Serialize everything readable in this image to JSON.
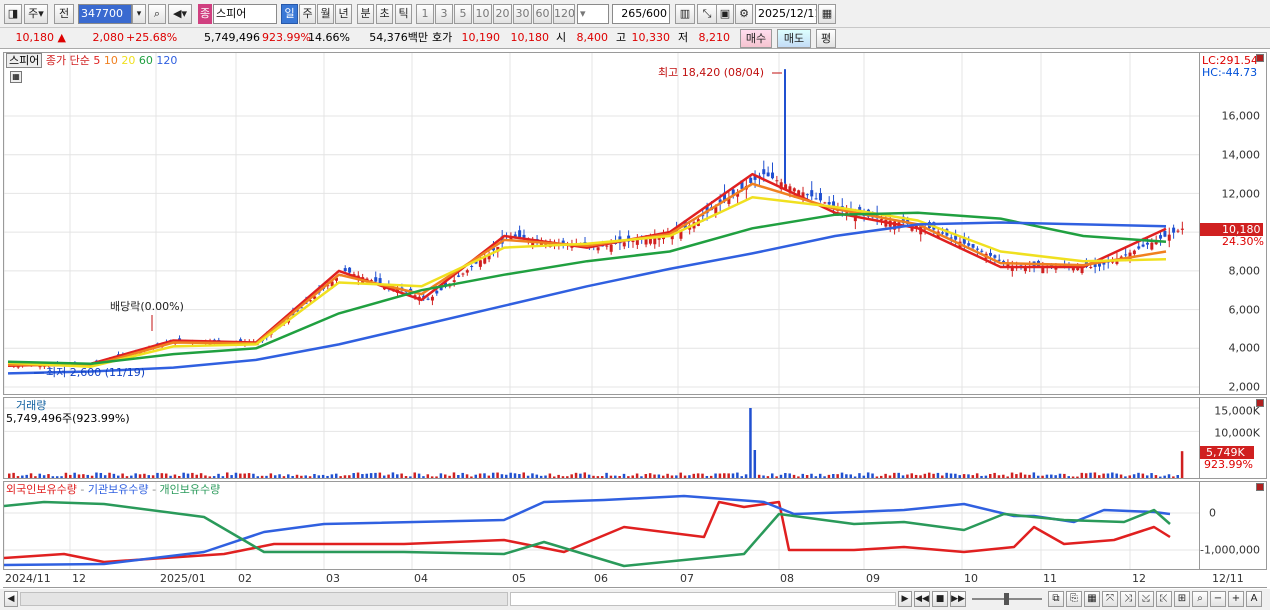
{
  "toolbar": {
    "market": "주",
    "prev_label": "전",
    "code": "347700",
    "name_tag": "종",
    "name": "스피어",
    "periods": [
      "일",
      "주",
      "월",
      "년",
      "분",
      "초",
      "틱"
    ],
    "period_selected": "일",
    "intervals": [
      "1",
      "3",
      "5",
      "10",
      "20",
      "30",
      "60",
      "120"
    ],
    "count": "265",
    "count_max": "/600",
    "date": "2025/12/11"
  },
  "quote": {
    "price": "10,180",
    "arrow": "▲",
    "change": "2,080",
    "change_pct": "+25.68%",
    "volume": "5,749,496",
    "vol_ratio": "923.99%",
    "turnover": "14.66%",
    "amount": "54,376백만",
    "bid_label": "호가",
    "ask": "10,190",
    "bid": "10,180",
    "open_label": "시",
    "open": "8,400",
    "high_label": "고",
    "high": "10,330",
    "low_label": "저",
    "low": "8,210",
    "buy_label": "매수",
    "sell_label": "매도",
    "eval_label": "평"
  },
  "price_panel": {
    "stock_tag": "스피어",
    "legend_prefix": "종가 단순",
    "ma": [
      {
        "label": "5",
        "color": "#e02020"
      },
      {
        "label": "10",
        "color": "#f08020"
      },
      {
        "label": "20",
        "color": "#f0e020"
      },
      {
        "label": "60",
        "color": "#20a040"
      },
      {
        "label": "120",
        "color": "#3060e0"
      }
    ],
    "lc": "LC:291.54",
    "hc": "HC:-44.73",
    "high_annotation": "최고 18,420 (08/04)",
    "low_annotation": "최저 2,600 (11/19)",
    "dividend_annotation": "배당락(0.00%)",
    "last_price_tag": "10,180",
    "last_pct_tag": "24.30%",
    "yticks": [
      "16,000",
      "14,000",
      "12,000",
      "10,000",
      "8,000",
      "6,000",
      "4,000",
      "2,000"
    ]
  },
  "volume_panel": {
    "title": "거래량",
    "value": "5,749,496주(923.99%)",
    "yticks": [
      "15,000K",
      "10,000K"
    ],
    "last_tag": "5,749K",
    "last_pct": "923.99%"
  },
  "holding_panel": {
    "series": [
      {
        "label": "외국인보유수량",
        "color": "#e02020"
      },
      {
        "label": "기관보유수량",
        "color": "#3060e0"
      },
      {
        "label": "개인보유수량",
        "color": "#2a9a5a"
      }
    ],
    "yticks": [
      "0",
      "-1,000,000"
    ]
  },
  "x_axis": {
    "labels": [
      "2024/11",
      "12",
      "2025/01",
      "02",
      "03",
      "04",
      "05",
      "06",
      "07",
      "08",
      "09",
      "10",
      "11",
      "12"
    ],
    "right_label": "12/11"
  },
  "chart_data": {
    "type": "line",
    "x": [
      "2024/11",
      "12",
      "2025/01",
      "02",
      "03",
      "04",
      "05",
      "06",
      "07",
      "08",
      "09",
      "10",
      "11",
      "12",
      "12/11"
    ],
    "ylim": [
      2000,
      18500
    ],
    "series": [
      {
        "name": "5",
        "values": [
          3100,
          3200,
          4400,
          4300,
          8000,
          6500,
          9800,
          9200,
          10000,
          13000,
          11000,
          10200,
          8200,
          8200,
          10180
        ]
      },
      {
        "name": "10",
        "values": [
          3150,
          3100,
          4300,
          4250,
          7800,
          6800,
          9600,
          9300,
          9900,
          12500,
          11200,
          10400,
          8400,
          8300,
          9000
        ]
      },
      {
        "name": "20",
        "values": [
          3250,
          3050,
          4100,
          4200,
          7400,
          7200,
          9200,
          9400,
          9800,
          11800,
          11300,
          10600,
          9000,
          8500,
          8600
        ]
      },
      {
        "name": "60",
        "values": [
          3300,
          3200,
          3700,
          4000,
          5800,
          7000,
          7800,
          8500,
          9000,
          10200,
          10900,
          11000,
          10700,
          9800,
          9500
        ]
      },
      {
        "name": "120",
        "values": [
          2700,
          2800,
          3000,
          3400,
          4200,
          5200,
          6200,
          7200,
          8100,
          8900,
          9800,
          10400,
          10500,
          10400,
          10300
        ]
      }
    ],
    "volume_last_k": 5749,
    "volume_max_k": 15000
  }
}
